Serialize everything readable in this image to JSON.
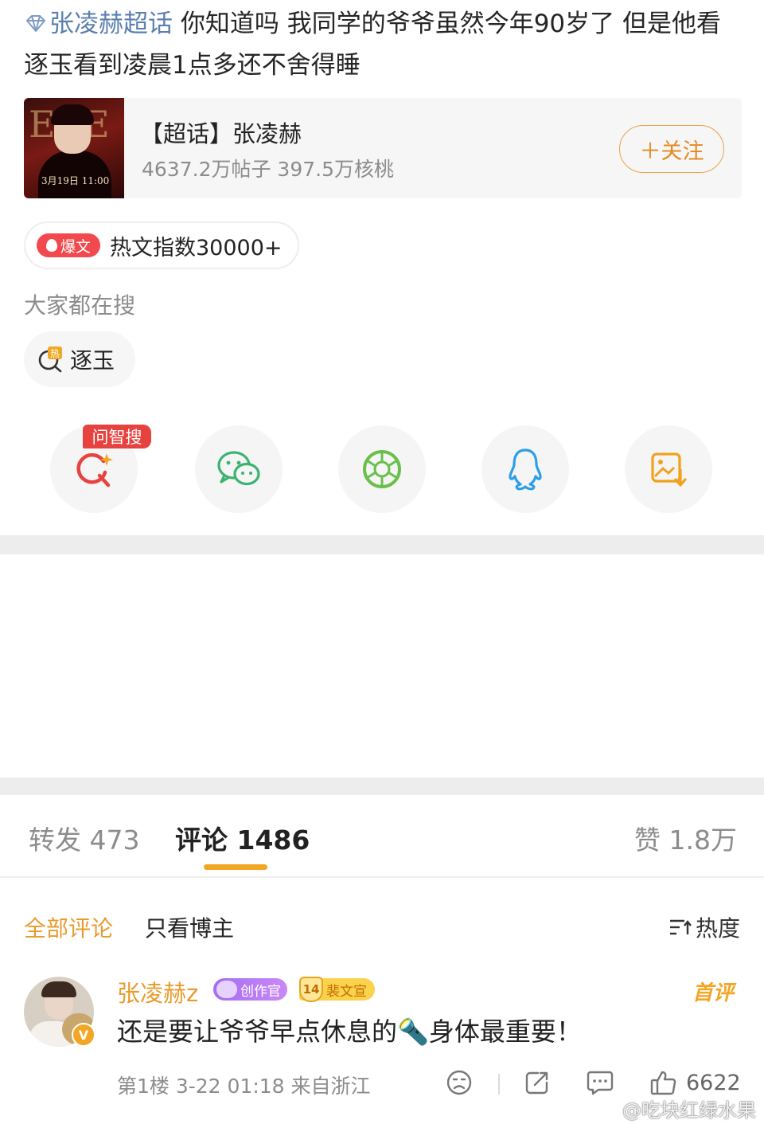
{
  "post": {
    "topic_link": "张凌赫超话",
    "body": "  你知道吗 我同学的爷爷虽然今年90岁了 但是他看逐玉看到凌晨1点多还不舍得睡"
  },
  "topic_card": {
    "poster_date": "3月19日 11:00",
    "name": "【超话】张凌赫",
    "stats": "4637.2万帖子 397.5万核桃",
    "follow_label": "＋关注"
  },
  "hot": {
    "badge_label": "爆文",
    "index_text": "热文指数30000+"
  },
  "search": {
    "title": "大家都在搜",
    "chip_label": "逐玉",
    "chip_icon": "hot-search-icon"
  },
  "share": {
    "ask_tag": "问智搜",
    "items": [
      "ask-search-icon",
      "wechat-icon",
      "moments-icon",
      "qq-icon",
      "save-image-icon"
    ]
  },
  "tabs": {
    "repost": "转发 473",
    "comment": "评论 1486",
    "like": "赞 1.8万"
  },
  "filters": {
    "all": "全部评论",
    "owner_only": "只看博主",
    "sort": "热度"
  },
  "comment": {
    "username": "张凌赫z",
    "creator_badge": "创作官",
    "fan_level": "14",
    "fan_badge": "裴文宣",
    "first_label": "首评",
    "text": "还是要让爷爷早点休息的🔦身体最重要！",
    "meta": "第1楼  3-22 01:18  来自浙江",
    "like_count": "6622"
  },
  "watermark": "@吃块红绿水果",
  "colors": {
    "accent": "#e89b2c",
    "link": "#5b7fb0",
    "hot_red": "#f2494e",
    "underline": "#f2a623"
  }
}
